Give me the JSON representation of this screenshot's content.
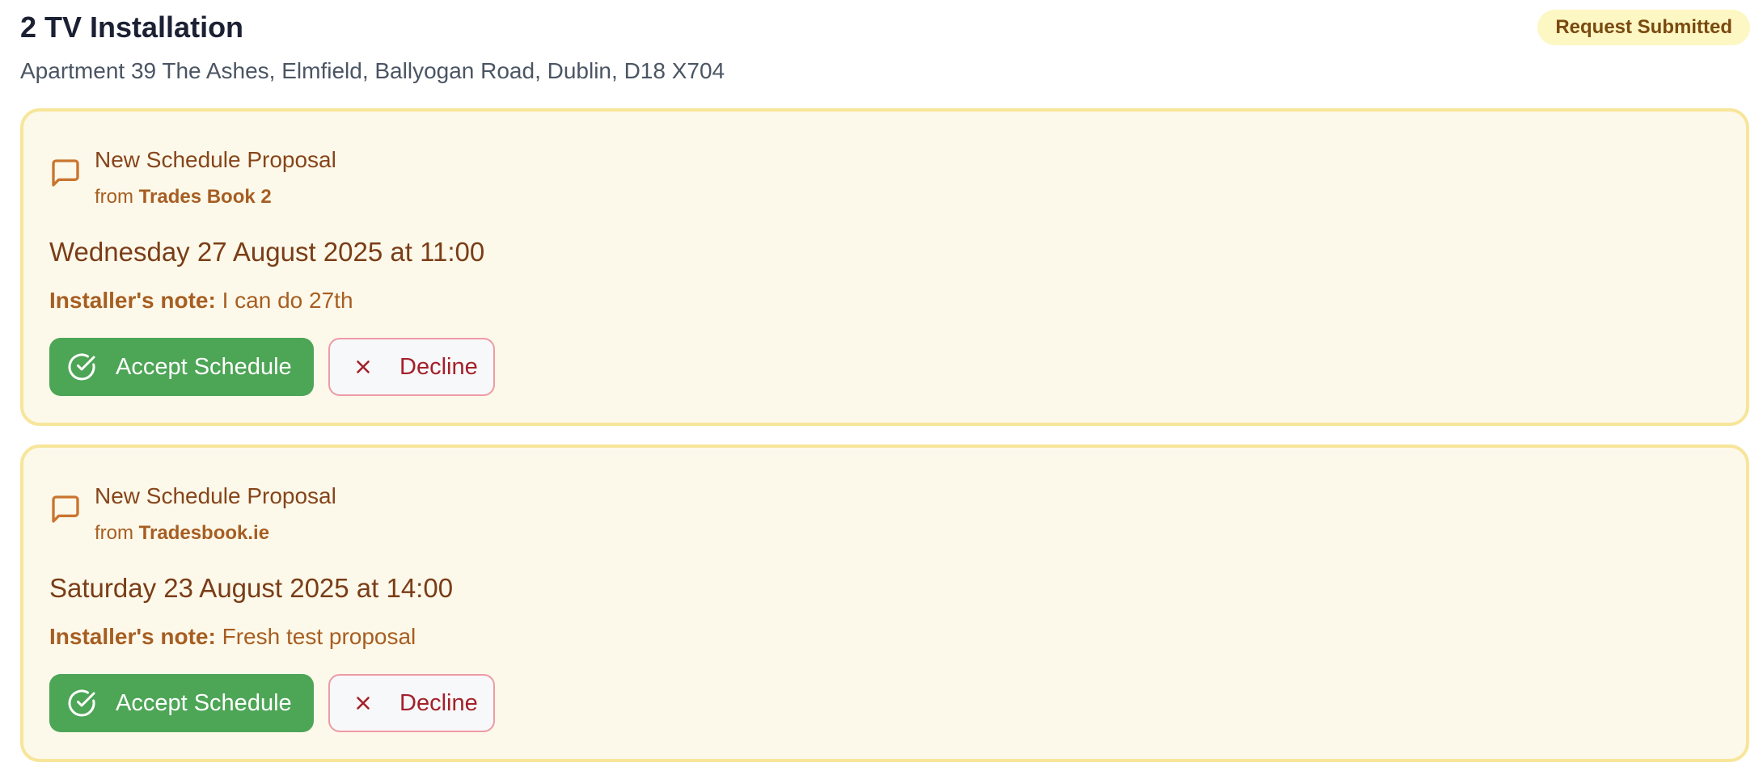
{
  "job": {
    "title": "2 TV Installation",
    "address": "Apartment 39 The Ashes, Elmfield, Ballyogan Road, Dublin, D18 X704",
    "status": "Request Submitted"
  },
  "proposals": [
    {
      "heading": "New Schedule Proposal",
      "from_prefix": "from",
      "from_name": "Trades Book 2",
      "datetime": "Wednesday 27 August 2025 at 11:00",
      "note_label": "Installer's note:",
      "note_text": "I can do 27th",
      "accept_label": "Accept Schedule",
      "decline_label": "Decline"
    },
    {
      "heading": "New Schedule Proposal",
      "from_prefix": "from",
      "from_name": "Tradesbook.ie",
      "datetime": "Saturday 23 August 2025 at 14:00",
      "note_label": "Installer's note:",
      "note_text": "Fresh test proposal",
      "accept_label": "Accept Schedule",
      "decline_label": "Decline"
    }
  ],
  "icons": {
    "message": "message-square-icon",
    "accept": "check-circle-icon",
    "decline": "x-icon"
  },
  "colors": {
    "accept_button": "#4da556",
    "decline_text": "#a3202a",
    "card_background": "#fdf9ea",
    "card_border": "#f7e59a",
    "status_badge": "#fdf7c3"
  }
}
